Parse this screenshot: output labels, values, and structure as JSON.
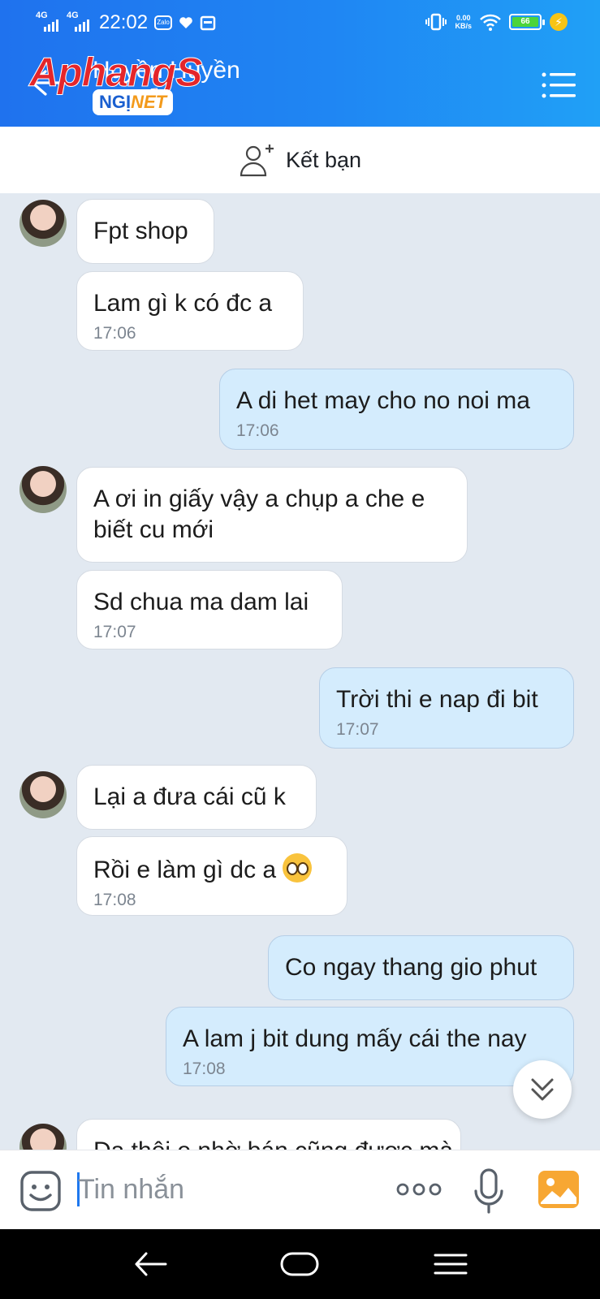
{
  "status_bar": {
    "signal1": "4G",
    "signal2": "4G",
    "time": "22:02",
    "app_icon_text": "Zalo",
    "net_speed_value": "0.00",
    "net_speed_unit": "KB/s",
    "battery": "66"
  },
  "header": {
    "contact_name": "Huyền Huyền",
    "watermark_brand_a": "Aphang",
    "watermark_brand_b": "S",
    "watermark_badge_a": "NGỊ",
    "watermark_badge_b": "NET"
  },
  "friend_bar": {
    "label": "Kết bạn"
  },
  "messages": [
    {
      "dir": "in",
      "text": "Fpt shop",
      "time": ""
    },
    {
      "dir": "in",
      "text": "Lam gì k có đc a",
      "time": "17:06"
    },
    {
      "dir": "out",
      "text": "A di het may cho no noi ma",
      "time": "17:06"
    },
    {
      "dir": "in",
      "text_line1": "A ơi in giấy vậy a chụp a che e",
      "text_line2": "biết cu mới",
      "time": ""
    },
    {
      "dir": "in",
      "text": "Sd chua ma dam lai",
      "time": "17:07"
    },
    {
      "dir": "out",
      "text": "Trời thi e nap đi bit",
      "time": "17:07"
    },
    {
      "dir": "in",
      "text": "Lại a đưa cái cũ k",
      "time": ""
    },
    {
      "dir": "in",
      "text": "Rồi e làm gì dc a",
      "time": "17:08",
      "emoji": "flushed-face"
    },
    {
      "dir": "out",
      "text": "Co ngay thang gio phut",
      "time": ""
    },
    {
      "dir": "out",
      "text": "A lam j bit dung mấy cái the nay",
      "time": "17:08"
    },
    {
      "dir": "in",
      "text": "Dạ thôi e nhờ bán cũng được mà",
      "time": ""
    }
  ],
  "input": {
    "placeholder": "Tin nhắn",
    "value": ""
  },
  "colors": {
    "header_gradient_start": "#1f72ee",
    "header_gradient_end": "#20a0f6",
    "chat_background": "#e2e9f1",
    "incoming_bubble": "#ffffff",
    "outgoing_bubble": "#d4ecfd",
    "accent": "#1f78ee"
  },
  "icons": [
    "back-arrow-icon",
    "menu-icon",
    "add-friend-icon",
    "sticker-icon",
    "more-dots-icon",
    "microphone-icon",
    "image-icon",
    "chevron-double-down-icon",
    "nav-back-icon",
    "nav-home-icon",
    "nav-recents-icon"
  ]
}
